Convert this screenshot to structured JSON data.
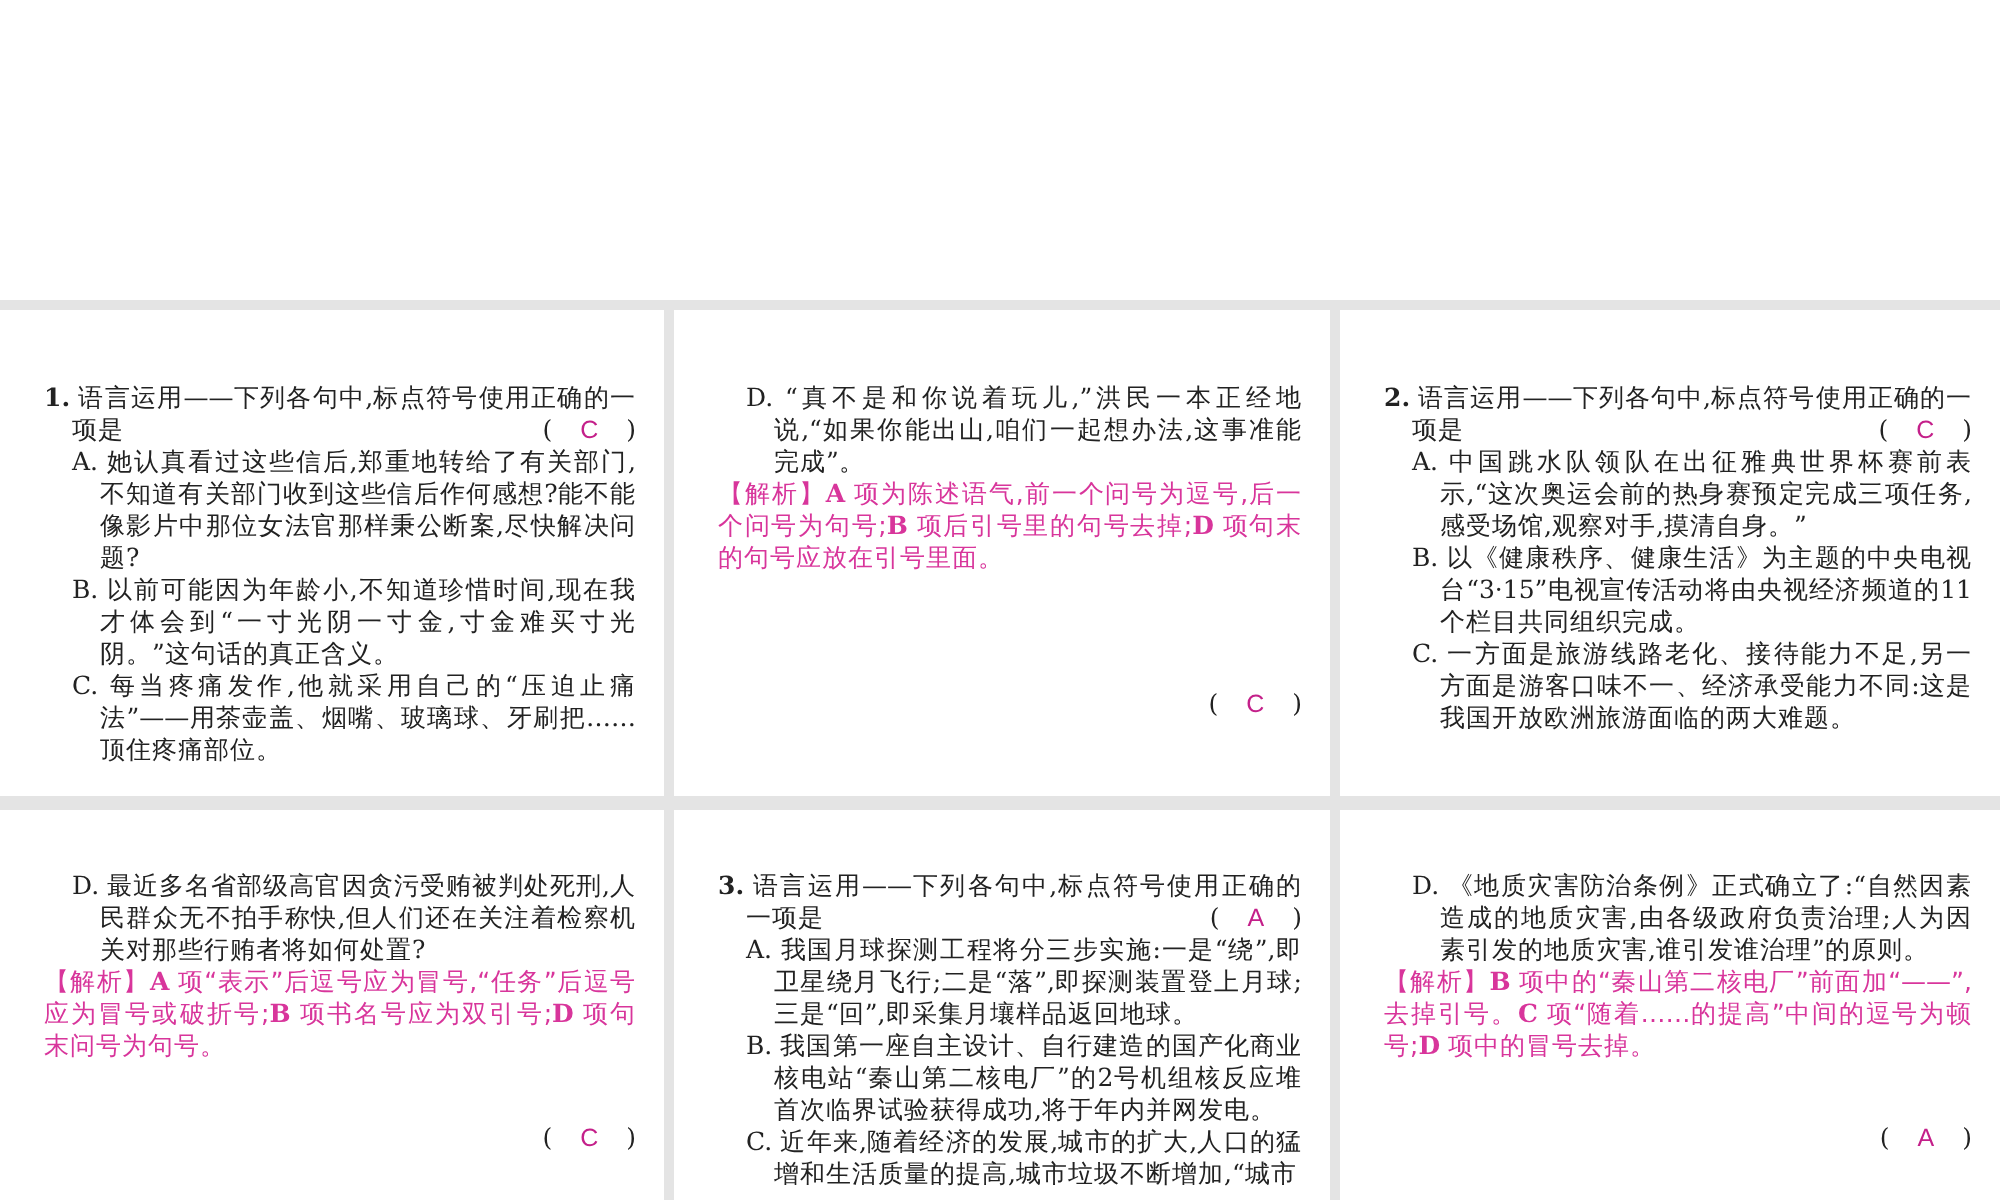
{
  "cards": [
    {
      "blocks": [
        {
          "kind": "question",
          "number": "1.",
          "text": "语言运用——下列各句中,标点符号使用正确的一项是",
          "answer": {
            "open": "(",
            "letter": "C",
            "close": ")"
          }
        },
        {
          "kind": "option",
          "label": "A.",
          "text": "她认真看过这些信后,郑重地转给了有关部门,不知道有关部门收到这些信后作何感想?能不能像影片中那位女法官那样秉公断案,尽快解决问题?"
        },
        {
          "kind": "option",
          "label": "B.",
          "text": "以前可能因为年龄小,不知道珍惜时间,现在我才体会到“一寸光阴一寸金,寸金难买寸光阴。”这句话的真正含义。"
        },
        {
          "kind": "option",
          "label": "C.",
          "text": "每当疼痛发作,他就采用自己的“压迫止痛法”——用茶壶盖、烟嘴、玻璃球、牙刷把……顶住疼痛部位。"
        }
      ]
    },
    {
      "blocks": [
        {
          "kind": "option",
          "label": "D.",
          "text": "“真不是和你说着玩儿,”洪民一本正经地说,“如果你能出山,咱们一起想办法,这事准能完成”。"
        },
        {
          "kind": "analysis",
          "label": "【解析】",
          "text": "**A** 项为陈述语气,前一个问号为逗号,后一个问号为句号;**B** 项后引号里的句号去掉;**D** 项句末的句号应放在引号里面。"
        },
        {
          "kind": "answer",
          "answer": {
            "open": "(",
            "letter": "C",
            "close": ")"
          }
        }
      ]
    },
    {
      "blocks": [
        {
          "kind": "question",
          "number": "2.",
          "text": "语言运用——下列各句中,标点符号使用正确的一项是",
          "answer": {
            "open": "(",
            "letter": "C",
            "close": ")"
          }
        },
        {
          "kind": "option",
          "label": "A.",
          "text": "中国跳水队领队在出征雅典世界杯赛前表示,“这次奥运会前的热身赛预定完成三项任务,感受场馆,观察对手,摸清自身。”"
        },
        {
          "kind": "option",
          "label": "B.",
          "text": "以《健康秩序、健康生活》为主题的中央电视台“3·15”电视宣传活动将由央视经济频道的11个栏目共同组织完成。"
        },
        {
          "kind": "option",
          "label": "C.",
          "text": "一方面是旅游线路老化、接待能力不足,另一方面是游客口味不一、经济承受能力不同:这是我国开放欧洲旅游面临的两大难题。"
        }
      ]
    },
    {
      "blocks": [
        {
          "kind": "option",
          "label": "D.",
          "text": "最近多名省部级高官因贪污受贿被判处死刑,人民群众无不拍手称快,但人们还在关注着检察机关对那些行贿者将如何处置?"
        },
        {
          "kind": "analysis",
          "label": "【解析】",
          "text": "**A** 项“表示”后逗号应为冒号,“任务”后逗号应为冒号或破折号;**B** 项书名号应为双引号;**D** 项句末问号为句号。"
        },
        {
          "kind": "answer",
          "answer": {
            "open": "(",
            "letter": "C",
            "close": ")"
          }
        }
      ]
    },
    {
      "blocks": [
        {
          "kind": "question",
          "number": "3.",
          "text": "语言运用——下列各句中,标点符号使用正确的一项是",
          "answer": {
            "open": "(",
            "letter": "A",
            "close": ")"
          }
        },
        {
          "kind": "option",
          "label": "A.",
          "text": "我国月球探测工程将分三步实施:一是“绕”,即卫星绕月飞行;二是“落”,即探测装置登上月球;三是“回”,即采集月壤样品返回地球。"
        },
        {
          "kind": "option",
          "label": "B.",
          "text": "我国第一座自主设计、自行建造的国产化商业核电站“秦山第二核电厂”的2号机组核反应堆首次临界试验获得成功,将于年内并网发电。"
        },
        {
          "kind": "option",
          "label": "C.",
          "text": "近年来,随着经济的发展,城市的扩大,人口的猛增和生活质量的提高,城市垃圾不断增加,“城市"
        }
      ]
    },
    {
      "blocks": [
        {
          "kind": "option",
          "label": "D.",
          "text": "《地质灾害防治条例》正式确立了:“自然因素造成的地质灾害,由各级政府负责治理;人为因素引发的地质灾害,谁引发谁治理”的原则。"
        },
        {
          "kind": "analysis",
          "label": "【解析】",
          "text": "**B** 项中的“秦山第二核电厂”前面加“——”,去掉引号。**C** 项“随着……的提高”中间的逗号为顿号;**D** 项中的冒号去掉。"
        },
        {
          "kind": "answer",
          "answer": {
            "open": "(",
            "letter": "A",
            "close": ")"
          }
        }
      ]
    }
  ]
}
